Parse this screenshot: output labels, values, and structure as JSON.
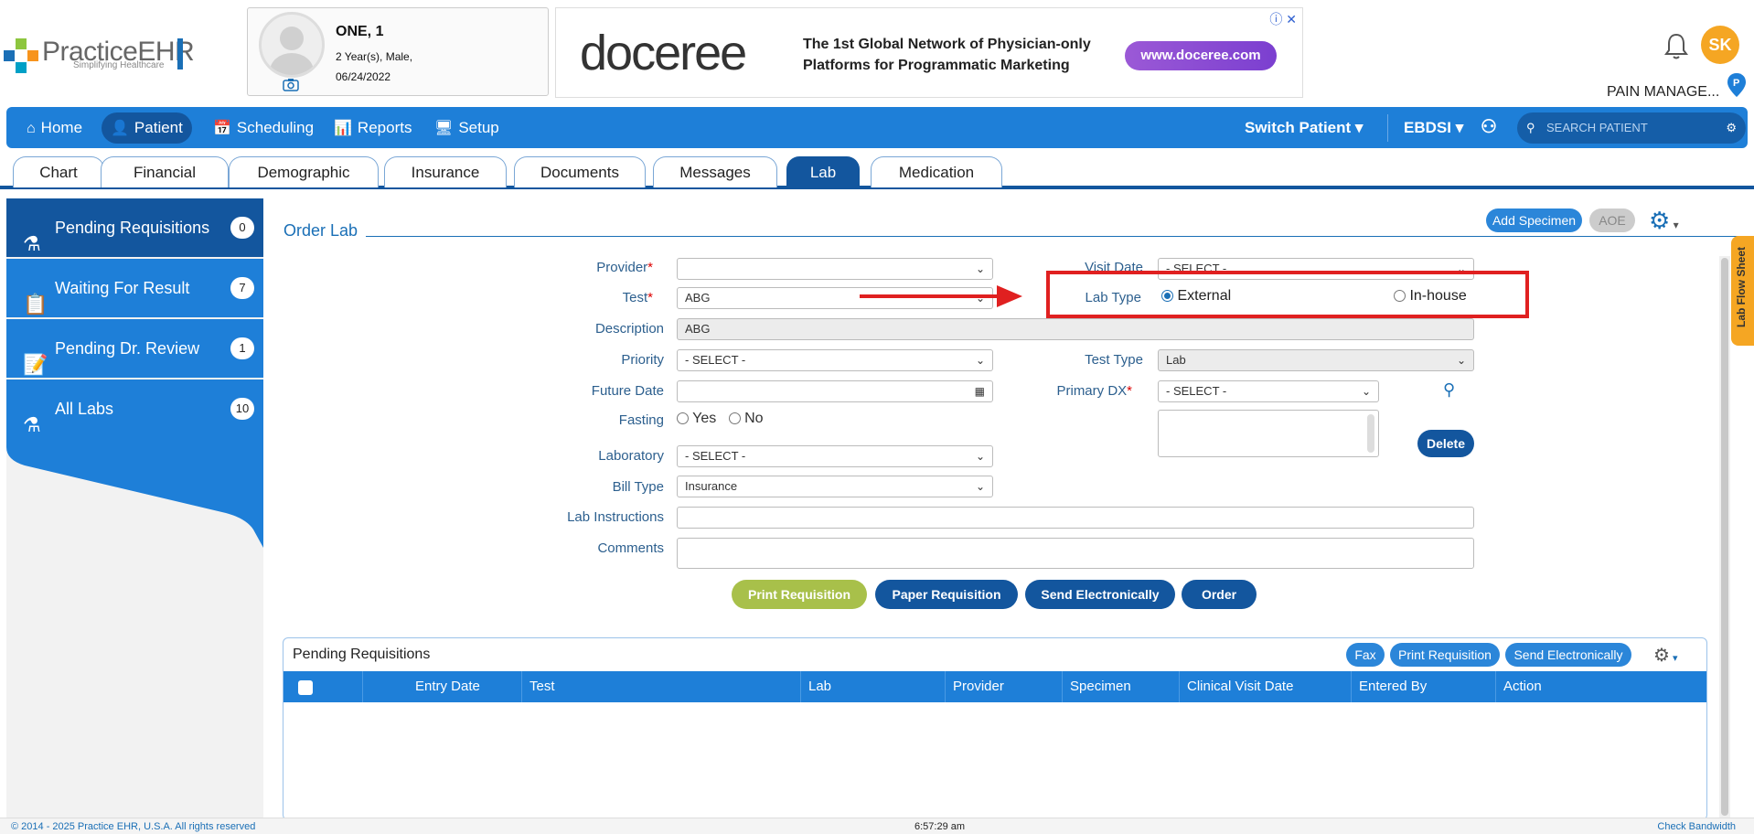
{
  "header": {
    "logo_text": "PracticeEHR",
    "logo_sub": "Simplifying Healthcare",
    "patient": {
      "name": "ONE, 1",
      "age_sex": "2 Year(s), Male,",
      "dob": "06/24/2022"
    },
    "ad": {
      "brand": "doceree",
      "text_line1": "The 1st Global Network of Physician-only",
      "text_line2": "Platforms for Programmatic Marketing",
      "url": "www.doceree.com"
    },
    "user_initials": "SK",
    "practice": "PAIN MANAGE..."
  },
  "nav": {
    "items": [
      {
        "label": "Home",
        "icon": "home-icon"
      },
      {
        "label": "Patient",
        "icon": "user-icon"
      },
      {
        "label": "Scheduling",
        "icon": "calendar-icon"
      },
      {
        "label": "Reports",
        "icon": "chart-icon"
      },
      {
        "label": "Setup",
        "icon": "monitor-icon"
      }
    ],
    "switch_patient": "Switch Patient",
    "org": "EBDSI",
    "search_placeholder": "SEARCH PATIENT"
  },
  "tabs": [
    "Chart",
    "Financial",
    "Demographic",
    "Insurance",
    "Documents",
    "Messages",
    "Lab",
    "Medication"
  ],
  "sidebar": {
    "items": [
      {
        "label": "Pending Requisitions",
        "count": "0"
      },
      {
        "label": "Waiting For Result",
        "count": "7"
      },
      {
        "label": "Pending Dr. Review",
        "count": "1"
      },
      {
        "label": "All Labs",
        "count": "10"
      }
    ]
  },
  "order": {
    "title": "Order Lab",
    "add_specimen": "Add Specimen",
    "aoe": "AOE",
    "labels": {
      "provider": "Provider",
      "test": "Test",
      "description": "Description",
      "priority": "Priority",
      "future_date": "Future Date",
      "fasting": "Fasting",
      "laboratory": "Laboratory",
      "bill_type": "Bill Type",
      "lab_instructions": "Lab Instructions",
      "comments": "Comments",
      "visit_date": "Visit Date",
      "lab_type": "Lab Type",
      "test_type": "Test Type",
      "primary_dx": "Primary DX"
    },
    "values": {
      "provider": "",
      "test": "ABG",
      "description": "ABG",
      "priority": "- SELECT -",
      "future_date": "",
      "fasting_yes": "Yes",
      "fasting_no": "No",
      "laboratory": "- SELECT -",
      "bill_type": "Insurance",
      "visit_date": "- SELECT -",
      "lab_type_external": "External",
      "lab_type_inhouse": "In-house",
      "test_type": "Lab",
      "primary_dx": "- SELECT -"
    },
    "delete": "Delete",
    "buttons": {
      "print": "Print Requisition",
      "paper": "Paper Requisition",
      "send": "Send Electronically",
      "order": "Order"
    }
  },
  "pending": {
    "title": "Pending Requisitions",
    "fax": "Fax",
    "print": "Print Requisition",
    "send": "Send Electronically",
    "columns": [
      "Entry Date",
      "Test",
      "Lab",
      "Provider",
      "Specimen",
      "Clinical Visit Date",
      "Entered By",
      "Action"
    ]
  },
  "flowsheet_label": "Lab Flow Sheet",
  "footer": {
    "copyright": "© 2014 - 2025 Practice EHR, U.S.A. All rights reserved",
    "time": "6:57:29 am",
    "bandwidth": "Check Bandwidth"
  }
}
